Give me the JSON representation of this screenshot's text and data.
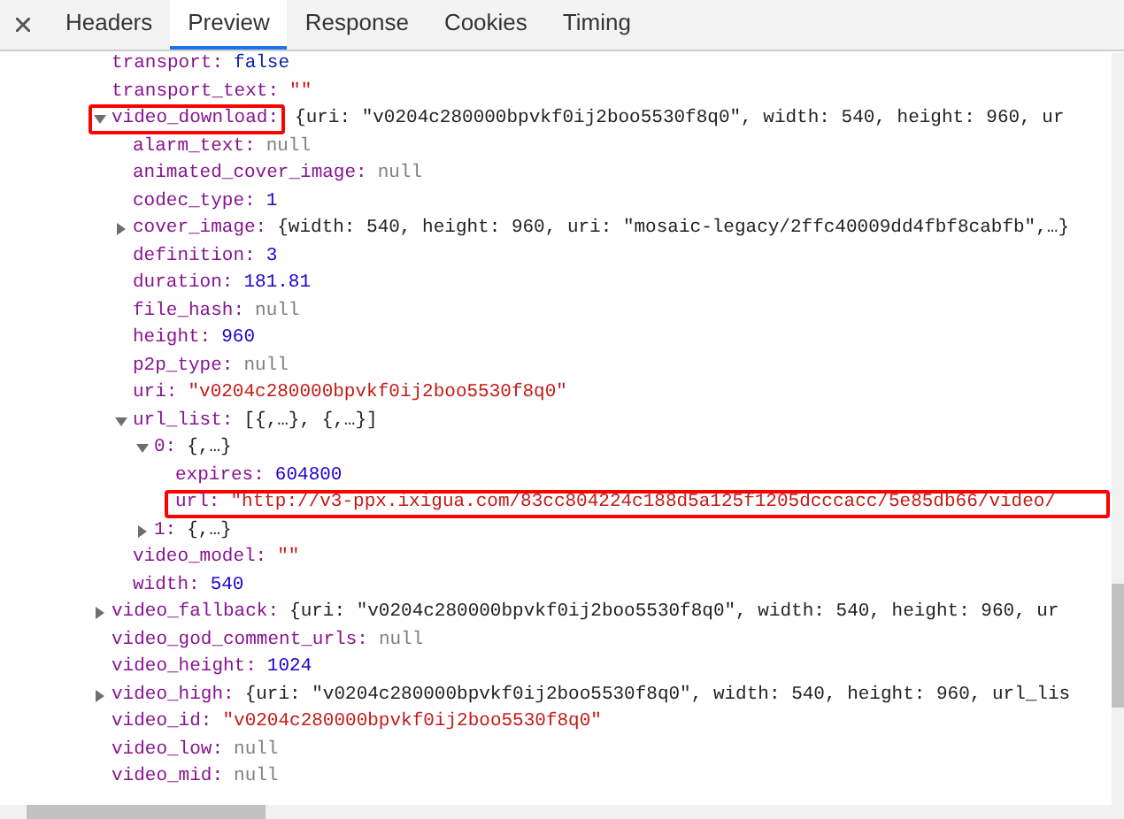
{
  "tabs": [
    {
      "label": "Headers",
      "selected": false
    },
    {
      "label": "Preview",
      "selected": true
    },
    {
      "label": "Response",
      "selected": false
    },
    {
      "label": "Cookies",
      "selected": false
    },
    {
      "label": "Timing",
      "selected": false
    }
  ],
  "properties": [
    {
      "key": "transport:",
      "value": "false",
      "kind": "keyword"
    },
    {
      "key": "transport_text:",
      "value": "\"\"",
      "kind": "string"
    },
    {
      "key": "video_download:",
      "value": "{uri: \"v0204c280000bpvkf0ij2boo5530f8q0\", width: 540, height: 960, ur",
      "kind": "object",
      "expanded": true,
      "highlighted": true,
      "children": [
        {
          "key": "alarm_text:",
          "value": "null",
          "kind": "null"
        },
        {
          "key": "animated_cover_image:",
          "value": "null",
          "kind": "null"
        },
        {
          "key": "codec_type:",
          "value": "1",
          "kind": "number"
        },
        {
          "key": "cover_image:",
          "value": "{width: 540, height: 960, uri: \"mosaic-legacy/2ffc40009dd4fbf8cabfb\",…}",
          "kind": "object",
          "expanded": false
        },
        {
          "key": "definition:",
          "value": "3",
          "kind": "number"
        },
        {
          "key": "duration:",
          "value": "181.81",
          "kind": "number"
        },
        {
          "key": "file_hash:",
          "value": "null",
          "kind": "null"
        },
        {
          "key": "height:",
          "value": "960",
          "kind": "number"
        },
        {
          "key": "p2p_type:",
          "value": "null",
          "kind": "null"
        },
        {
          "key": "uri:",
          "value": "\"v0204c280000bpvkf0ij2boo5530f8q0\"",
          "kind": "string"
        },
        {
          "key": "url_list:",
          "value": "[{,…}, {,…}]",
          "kind": "object",
          "expanded": true,
          "children": [
            {
              "key": "0:",
              "value": "{,…}",
              "kind": "object",
              "expanded": true,
              "children": [
                {
                  "key": "expires:",
                  "value": "604800",
                  "kind": "number"
                },
                {
                  "key": "url:",
                  "value": "\"http://v3-ppx.ixigua.com/83cc804224c188d5a125f1205dcccacc/5e85db66/video/",
                  "kind": "string",
                  "highlighted": true
                }
              ]
            },
            {
              "key": "1:",
              "value": "{,…}",
              "kind": "object",
              "expanded": false
            }
          ]
        },
        {
          "key": "video_model:",
          "value": "\"\"",
          "kind": "string"
        },
        {
          "key": "width:",
          "value": "540",
          "kind": "number"
        }
      ]
    },
    {
      "key": "video_fallback:",
      "value": "{uri: \"v0204c280000bpvkf0ij2boo5530f8q0\", width: 540, height: 960, ur",
      "kind": "object",
      "expanded": false
    },
    {
      "key": "video_god_comment_urls:",
      "value": "null",
      "kind": "null"
    },
    {
      "key": "video_height:",
      "value": "1024",
      "kind": "number"
    },
    {
      "key": "video_high:",
      "value": "{uri: \"v0204c280000bpvkf0ij2boo5530f8q0\", width: 540, height: 960, url_lis",
      "kind": "object",
      "expanded": false
    },
    {
      "key": "video_id:",
      "value": "\"v0204c280000bpvkf0ij2boo5530f8q0\"",
      "kind": "string"
    },
    {
      "key": "video_low:",
      "value": "null",
      "kind": "null"
    },
    {
      "key": "video_mid:",
      "value": "null",
      "kind": "null"
    }
  ]
}
